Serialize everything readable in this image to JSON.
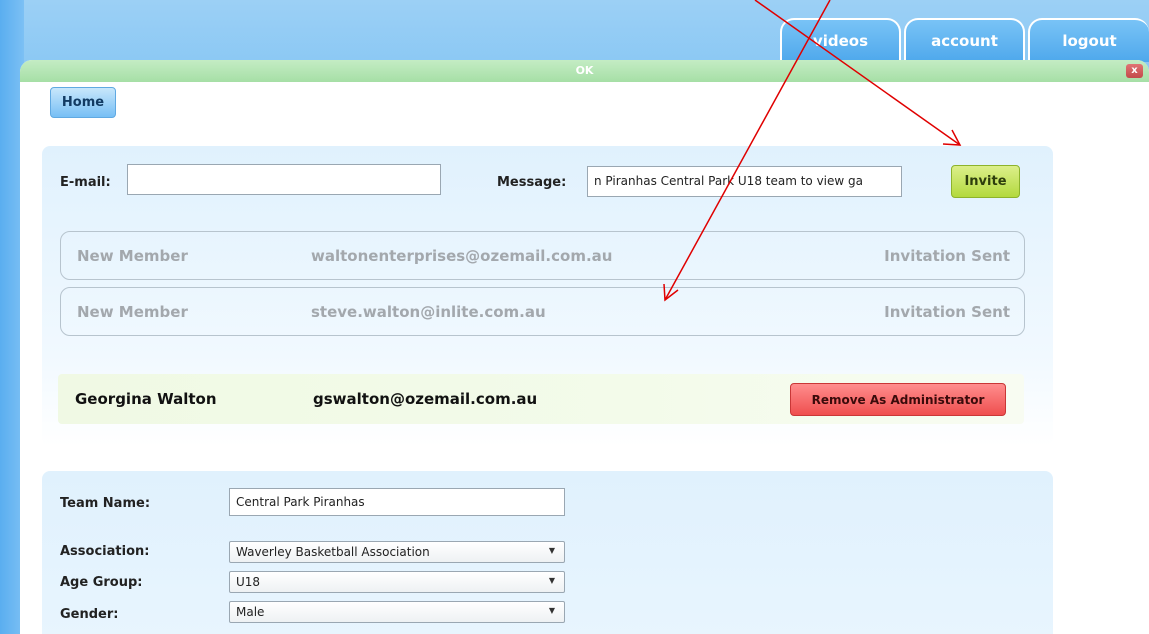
{
  "nav": {
    "tabs": [
      {
        "label": "videos"
      },
      {
        "label": "account"
      },
      {
        "label": "logout"
      }
    ]
  },
  "dialog": {
    "title": "OK",
    "close_glyph": "x",
    "home_label": "Home"
  },
  "invite": {
    "email_label": "E-mail:",
    "email_value": "",
    "message_label": "Message:",
    "message_value": "n Piranhas Central Park U18 team to view ga",
    "invite_label": "Invite"
  },
  "members": [
    {
      "name": "New Member",
      "email": "waltonenterprises@ozemail.com.au",
      "status": "Invitation Sent"
    },
    {
      "name": "New Member",
      "email": "steve.walton@inlite.com.au",
      "status": "Invitation Sent"
    }
  ],
  "admin": {
    "name": "Georgina Walton",
    "email": "gswalton@ozemail.com.au",
    "remove_label": "Remove As Administrator"
  },
  "team": {
    "team_name_label": "Team Name:",
    "team_name_value": "Central Park Piranhas",
    "association_label": "Association:",
    "association_value": "Waverley Basketball Association",
    "age_group_label": "Age Group:",
    "age_group_value": "U18",
    "gender_label": "Gender:",
    "gender_value": "Male",
    "dropdown_glyph": "▼"
  },
  "annotation": {
    "color": "#e00000"
  }
}
